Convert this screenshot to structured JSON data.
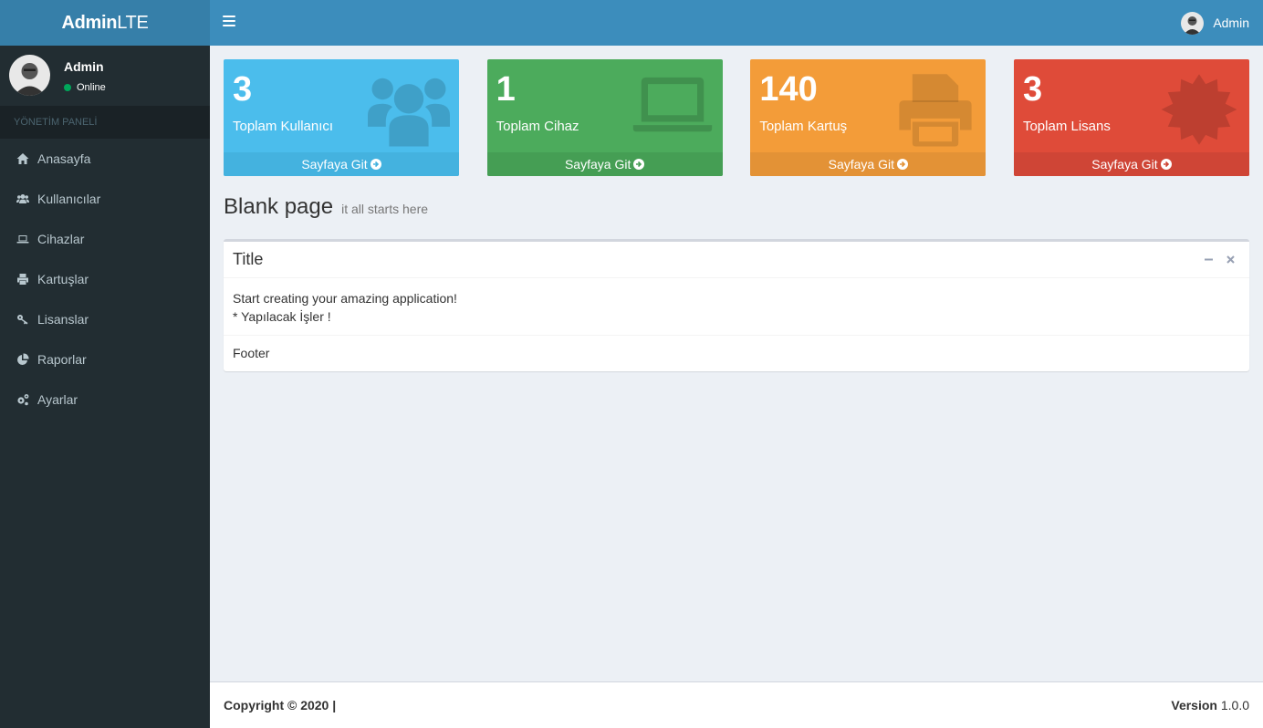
{
  "logo": {
    "bold": "Admin",
    "light": "LTE"
  },
  "navbar": {
    "user_name": "Admin"
  },
  "sidebar": {
    "user_name": "Admin",
    "status": "Online",
    "header": "YÖNETİM PANELİ",
    "items": [
      {
        "label": "Anasayfa",
        "icon": "home-icon"
      },
      {
        "label": "Kullanıcılar",
        "icon": "users-icon"
      },
      {
        "label": "Cihazlar",
        "icon": "laptop-icon"
      },
      {
        "label": "Kartuşlar",
        "icon": "print-icon"
      },
      {
        "label": "Lisanslar",
        "icon": "key-icon"
      },
      {
        "label": "Raporlar",
        "icon": "pie-chart-icon"
      },
      {
        "label": "Ayarlar",
        "icon": "cogs-icon"
      }
    ]
  },
  "stats": [
    {
      "value": "3",
      "label": "Toplam Kullanıcı",
      "link": "Sayfaya Git",
      "color": "#4bbdec",
      "icon": "users-icon"
    },
    {
      "value": "1",
      "label": "Toplam Cihaz",
      "link": "Sayfaya Git",
      "color": "#4cab5c",
      "icon": "laptop-icon"
    },
    {
      "value": "140",
      "label": "Toplam Kartuş",
      "link": "Sayfaya Git",
      "color": "#f39c39",
      "icon": "print-icon"
    },
    {
      "value": "3",
      "label": "Toplam Lisans",
      "link": "Sayfaya Git",
      "color": "#df4b39",
      "icon": "certificate-icon"
    }
  ],
  "page": {
    "title": "Blank page",
    "subtitle": "it all starts here"
  },
  "box": {
    "title": "Title",
    "body_line1": "Start creating your amazing application!",
    "body_line2": "* Yapılacak İşler !",
    "footer": "Footer"
  },
  "footer": {
    "copyright": "Copyright © 2020 |",
    "version_label": "Version",
    "version_value": "1.0.0"
  }
}
